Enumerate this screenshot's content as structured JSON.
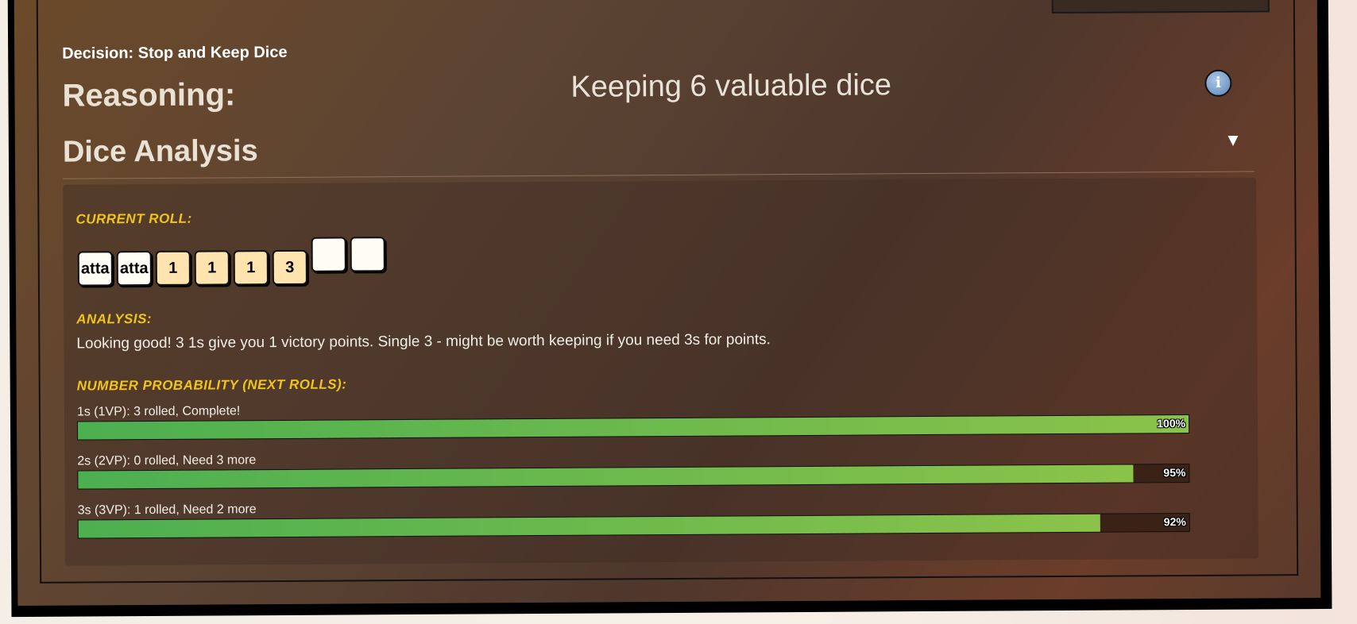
{
  "decision": "Decision: Stop and Keep Dice",
  "reasoning": {
    "label": "Reasoning:",
    "text": "Keeping 6 valuable dice"
  },
  "info_icon": "info-icon",
  "dice_analysis": {
    "title": "Dice Analysis",
    "toggle_icon": "▼",
    "current_roll_heading": "Current Roll:",
    "dice": [
      {
        "face": "atta",
        "style": "white",
        "kept": true
      },
      {
        "face": "atta",
        "style": "white",
        "kept": true
      },
      {
        "face": "1",
        "style": "cream",
        "kept": true
      },
      {
        "face": "1",
        "style": "cream",
        "kept": true
      },
      {
        "face": "1",
        "style": "cream",
        "kept": true
      },
      {
        "face": "3",
        "style": "cream",
        "kept": true
      },
      {
        "face": "",
        "style": "white",
        "kept": false
      },
      {
        "face": "",
        "style": "white",
        "kept": false
      }
    ],
    "analysis_heading": "Analysis:",
    "analysis_text": "Looking good! 3 1s give you 1 victory points. Single 3 - might be worth keeping if you need 3s for points.",
    "probability_heading": "Number Probability (Next Rolls):",
    "probabilities": [
      {
        "label": "1s (1VP): 3 rolled, Complete!",
        "percent": 100,
        "percent_label": "100%"
      },
      {
        "label": "2s (2VP): 0 rolled, Need 3 more",
        "percent": 95,
        "percent_label": "95%"
      },
      {
        "label": "3s (3VP): 1 rolled, Need 2 more",
        "percent": 92,
        "percent_label": "92%"
      }
    ]
  },
  "colors": {
    "heading_yellow": "#f0c419",
    "bar_green_start": "#4caf50",
    "bar_green_end": "#8bc34a"
  }
}
